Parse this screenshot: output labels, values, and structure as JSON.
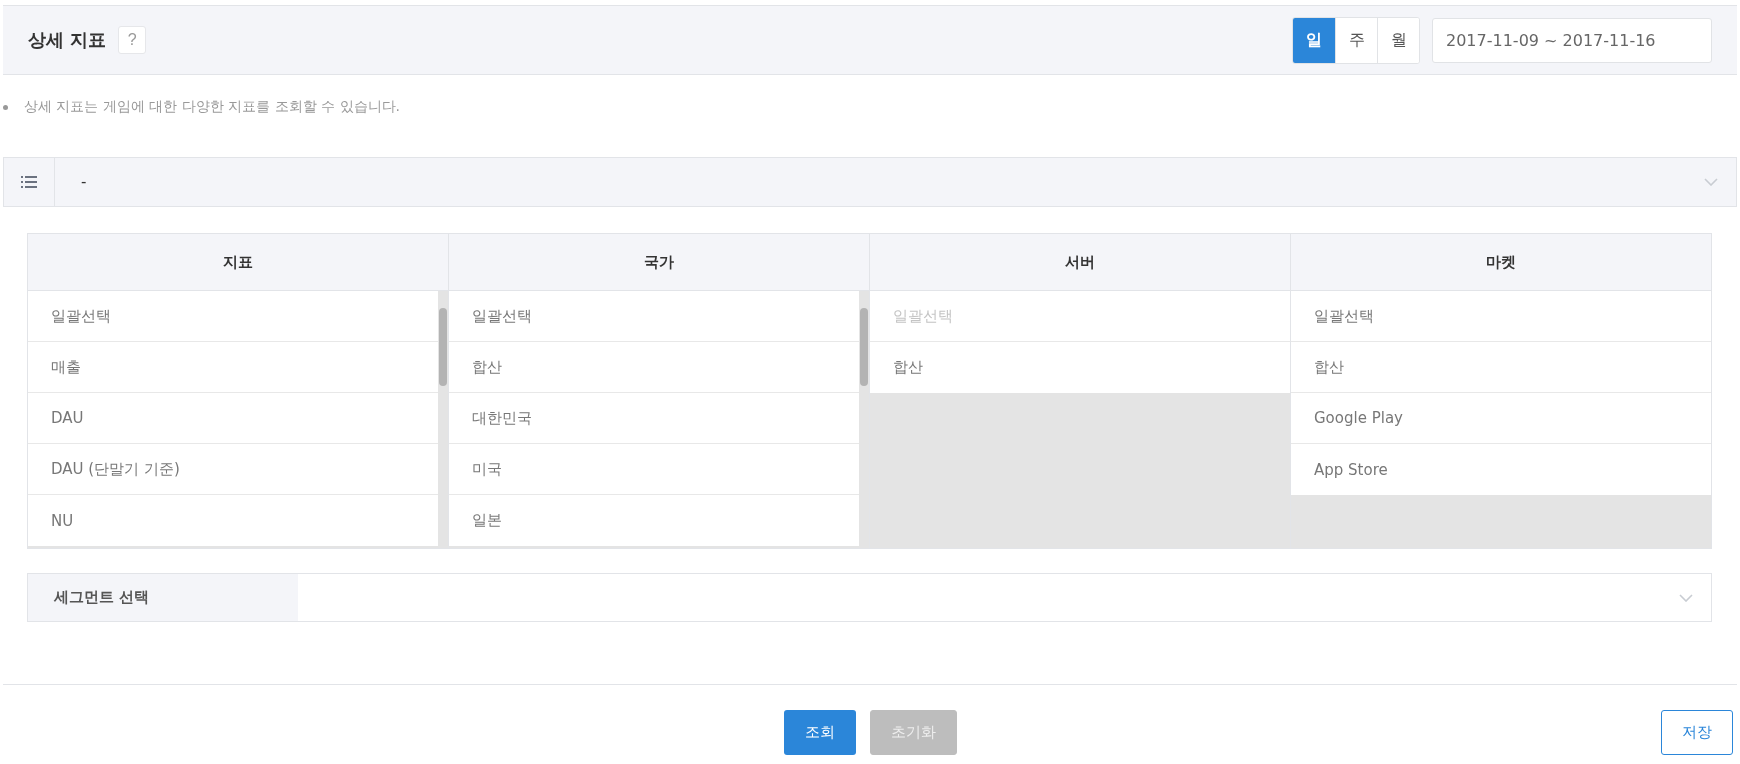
{
  "header": {
    "title": "상세 지표",
    "help": "?",
    "periods": [
      {
        "label": "일",
        "selected": true
      },
      {
        "label": "주",
        "selected": false
      },
      {
        "label": "월",
        "selected": false
      }
    ],
    "date_range": "2017-11-09 ~ 2017-11-16"
  },
  "notes": [
    "상세 지표는 게임에 대한 다양한 지표를 조회할 수 있습니다."
  ],
  "preset_select": {
    "value": "-"
  },
  "columns": [
    {
      "title": "지표",
      "scrollable": true,
      "items": [
        {
          "label": "일괄선택",
          "disabled": false
        },
        {
          "label": "매출",
          "disabled": false
        },
        {
          "label": "DAU",
          "disabled": false
        },
        {
          "label": "DAU (단말기 기준)",
          "disabled": false
        },
        {
          "label": "NU",
          "disabled": false
        }
      ]
    },
    {
      "title": "국가",
      "scrollable": true,
      "items": [
        {
          "label": "일괄선택",
          "disabled": false
        },
        {
          "label": "합산",
          "disabled": false
        },
        {
          "label": "대한민국",
          "disabled": false
        },
        {
          "label": "미국",
          "disabled": false
        },
        {
          "label": "일본",
          "disabled": false
        }
      ]
    },
    {
      "title": "서버",
      "scrollable": false,
      "items": [
        {
          "label": "일괄선택",
          "disabled": true
        },
        {
          "label": "합산",
          "disabled": false
        }
      ]
    },
    {
      "title": "마켓",
      "scrollable": false,
      "items": [
        {
          "label": "일괄선택",
          "disabled": false
        },
        {
          "label": "합산",
          "disabled": false
        },
        {
          "label": "Google Play",
          "disabled": false
        },
        {
          "label": "App Store",
          "disabled": false
        }
      ]
    }
  ],
  "segment": {
    "label": "세그먼트 선택"
  },
  "buttons": [
    {
      "label": "조회",
      "kind": "primary",
      "disabled": false
    },
    {
      "label": "초기화",
      "kind": "secondary",
      "disabled": true
    },
    {
      "label": "저장",
      "kind": "outline",
      "disabled": false
    }
  ]
}
